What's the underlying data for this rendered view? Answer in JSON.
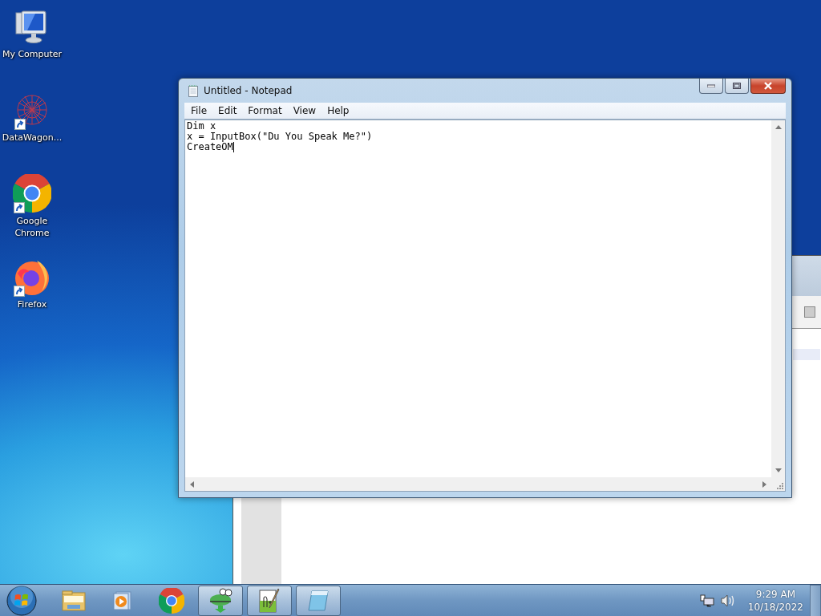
{
  "desktop_icons": [
    {
      "label": "My Computer",
      "kind": "computer",
      "shortcut": false
    },
    {
      "label": "DataWagon...",
      "kind": "network",
      "shortcut": true
    },
    {
      "label": "Google Chrome",
      "kind": "chrome",
      "shortcut": true
    },
    {
      "label": "Firefox",
      "kind": "firefox",
      "shortcut": true
    }
  ],
  "notepad": {
    "title": "Untitled - Notepad",
    "menu": [
      "File",
      "Edit",
      "Format",
      "View",
      "Help"
    ],
    "lines": [
      "Dim x",
      "x = InputBox(\"Du You Speak Me?\")",
      "CreateOM"
    ]
  },
  "taskbar": {
    "items": [
      {
        "kind": "folder",
        "running": false
      },
      {
        "kind": "media",
        "running": false
      },
      {
        "kind": "chrome",
        "running": false
      },
      {
        "kind": "gecko",
        "running": true
      },
      {
        "kind": "editor",
        "running": true
      },
      {
        "kind": "notepad",
        "running": true
      }
    ],
    "clock": {
      "time": "9:29 AM",
      "date": "10/18/2022"
    }
  }
}
